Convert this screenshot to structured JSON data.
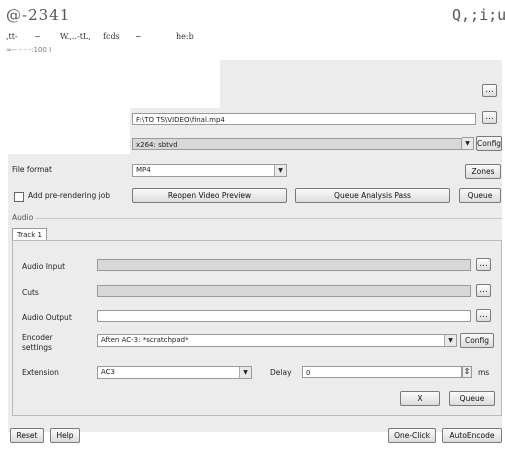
{
  "garbled_header": {
    "line1_left": "@-2341",
    "line1_right": "Q,;i;u",
    "line2_a": ",tt-",
    "line2_b": "~",
    "line2_c": "W.,..-tL,",
    "line2_d": "fcds",
    "line2_e": "~",
    "line2_f": "he:b",
    "line3": "≈-- - - -:100  I"
  },
  "video": {
    "output_path": "F:\\TO TS\\VIDEO\\final.mp4",
    "encoder_profile": "x264: sbtvd",
    "config_label": "Config",
    "file_format_label": "File format",
    "file_format_value": "MP4",
    "zones_label": "Zones",
    "prerender_label": "Add pre-rendering job",
    "reopen_label": "Reopen Video Preview",
    "queue_analysis_label": "Queue Analysis Pass",
    "queue_label": "Queue"
  },
  "audio": {
    "section_label": "Audio",
    "tab_label": "Track 1",
    "input_label": "Audio Input",
    "cuts_label": "Cuts",
    "output_label": "Audio Output",
    "encoder_label_1": "Encoder",
    "encoder_label_2": "settings",
    "encoder_value": "Aften AC-3: *scratchpad*",
    "config_label": "Config",
    "extension_label": "Extension",
    "extension_value": "AC3",
    "delay_label": "Delay",
    "delay_value": "0",
    "ms_label": "ms",
    "x_label": "X",
    "queue_label": "Queue"
  },
  "footer": {
    "reset_label": "Reset",
    "help_label": "Help",
    "oneclick_label": "One-Click",
    "autoencode_label": "AutoEncode"
  },
  "dots_label": "...",
  "dropdown_glyph": "▼",
  "spinner_glyph": "⇕"
}
